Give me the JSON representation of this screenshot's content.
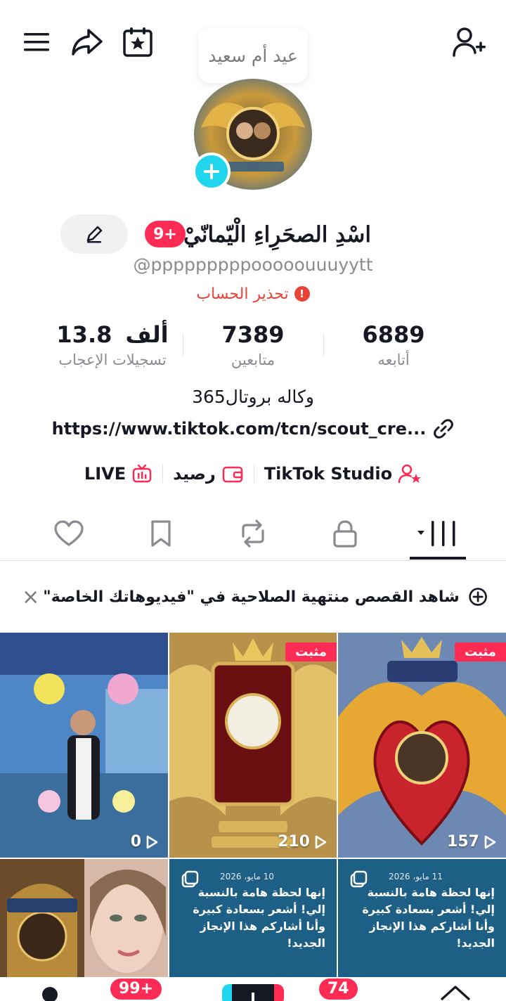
{
  "header": {
    "tooltip": "عيد أم سعيد",
    "icons": [
      "menu-icon",
      "share-icon",
      "calendar-star-icon",
      "add-friend-icon"
    ]
  },
  "profile": {
    "display_name": "اسْدِ الصحَرِاءِ الْيّمانّيْ",
    "notification_badge": "9+",
    "username": "@pppppppppooooouuuyytt",
    "warning": "تحذير الحساب",
    "stats": {
      "following": {
        "value": "6889",
        "label": "أتابعه"
      },
      "followers": {
        "value": "7389",
        "label": "متابعين"
      },
      "likes": {
        "value": "13.8",
        "unit": "ألف",
        "label": "تسجيلات الإعجاب"
      }
    },
    "bio": "وكاله بروتال365",
    "link": "https://www.tiktok.com/tcn/scout_cre..."
  },
  "tools": {
    "studio": "TikTok Studio",
    "balance": "رصيد",
    "live": "LIVE"
  },
  "banner": {
    "text": "شاهد القصص منتهية الصلاحية في \"فيديوهاتك الخاصة\""
  },
  "videos": [
    {
      "views": "157",
      "pinned": "مثبت"
    },
    {
      "views": "210",
      "pinned": "مثبت"
    },
    {
      "views": "0"
    }
  ],
  "notes": [
    {
      "date": "11 مايو، 2026",
      "text": "إنها لحظة هامة بالنسبة إلي! أشعر بسعادة كبيرة وأنا أشاركم هذا الإنجاز الجديد!"
    },
    {
      "date": "10 مايو، 2026",
      "text": "إنها لحظة هامة بالنسبة إلي! أشعر بسعادة كبيرة وأنا أشاركم هذا الإنجاز الجديد!"
    }
  ],
  "bottom_nav": {
    "inbox_badge": "99+",
    "friends_badge": "74"
  },
  "colors": {
    "accent": "#fe2c55",
    "cyan": "#20d5ec",
    "warning": "#ea4335",
    "note_bg": "#1e5f86"
  }
}
